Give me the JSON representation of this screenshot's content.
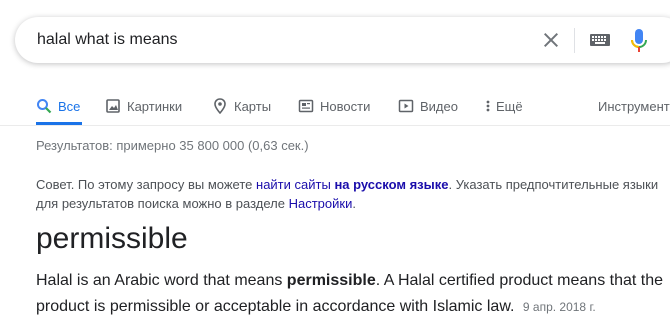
{
  "search": {
    "query": "halal what is means",
    "icons": {
      "clear": "close-icon",
      "keyboard": "keyboard-icon",
      "voice": "microphone-icon"
    },
    "colors": {
      "mic_blue": "#4285f4",
      "mic_red": "#ea4335",
      "mic_yellow": "#fbbc04",
      "mic_green": "#34a853"
    }
  },
  "tabs": [
    {
      "label": "Все",
      "icon": "search-icon",
      "active": true
    },
    {
      "label": "Картинки",
      "icon": "image-icon"
    },
    {
      "label": "Карты",
      "icon": "map-pin-icon"
    },
    {
      "label": "Новости",
      "icon": "news-icon"
    },
    {
      "label": "Видео",
      "icon": "video-icon"
    },
    {
      "label": "Ещё",
      "icon": "more-vert-icon"
    },
    {
      "label": "Инструменты"
    }
  ],
  "stats": "Результатов: примерно 35 800 000 (0,63 сек.)",
  "tip": {
    "prefix": "Совет. По этому запросу вы можете ",
    "link1": "найти сайты",
    "link_space": " ",
    "link2": "на русском языке",
    "middle": ". Указать предпочтительные языки для результатов поиска можно в разделе ",
    "settings_link": "Настройки",
    "suffix": "."
  },
  "answer": {
    "title": "permissible",
    "text_before": "Halal is an Arabic word that means ",
    "text_bold": "permissible",
    "text_after": ". A Halal certified product means that the product is permissible or acceptable in accordance with Islamic law.",
    "date": "9 апр. 2018 г."
  },
  "colors": {
    "accent": "#1a73e8",
    "link": "#1a0dab",
    "muted": "#70757a"
  }
}
